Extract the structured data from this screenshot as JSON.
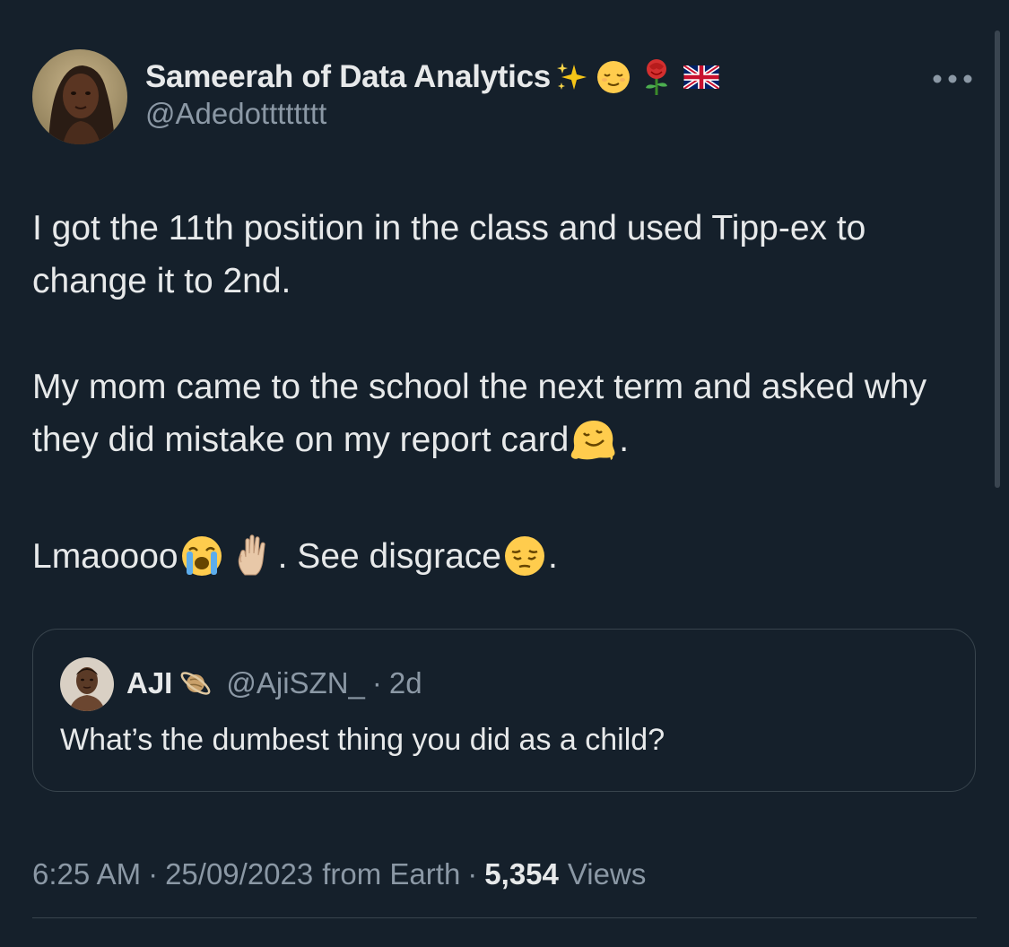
{
  "tweet": {
    "author": {
      "display_name": "Sameerah of Data Analytics",
      "name_emojis": [
        "sparkles-icon",
        "relieved-face-icon",
        "rose-icon",
        "uk-flag-icon"
      ],
      "handle": "@Adedotttttttt"
    },
    "more_icon": "more-horizontal-icon",
    "paragraphs": [
      {
        "text": "I got the 11th position in the class and used Tipp-ex to change it to 2nd."
      },
      {
        "text_before": "My mom came to the school the next term and asked why they did mistake on my report card",
        "emoji": "melting-face-icon",
        "text_after": "."
      },
      {
        "text_before": "Lmaoooo",
        "emoji_1": "loudly-crying-face-icon",
        "emoji_2": "raised-hand-icon",
        "text_middle": ". See disgrace",
        "emoji_3": "pensive-face-icon",
        "text_after": "."
      }
    ],
    "quoted": {
      "display_name": "AJI",
      "name_emoji": "ringed-planet-icon",
      "handle": "@AjiSZN_",
      "separator": "·",
      "time": "2d",
      "text": "What’s the dumbest thing you did as a child?"
    },
    "meta": {
      "time": "6:25 AM",
      "sep1": "·",
      "date": "25/09/2023",
      "source": "from Earth",
      "sep2": "·",
      "views_count": "5,354",
      "views_label": "Views"
    }
  },
  "colors": {
    "background": "#15202b",
    "text_primary": "#e7e9ea",
    "text_secondary": "#8b98a5",
    "border": "#38444d"
  }
}
